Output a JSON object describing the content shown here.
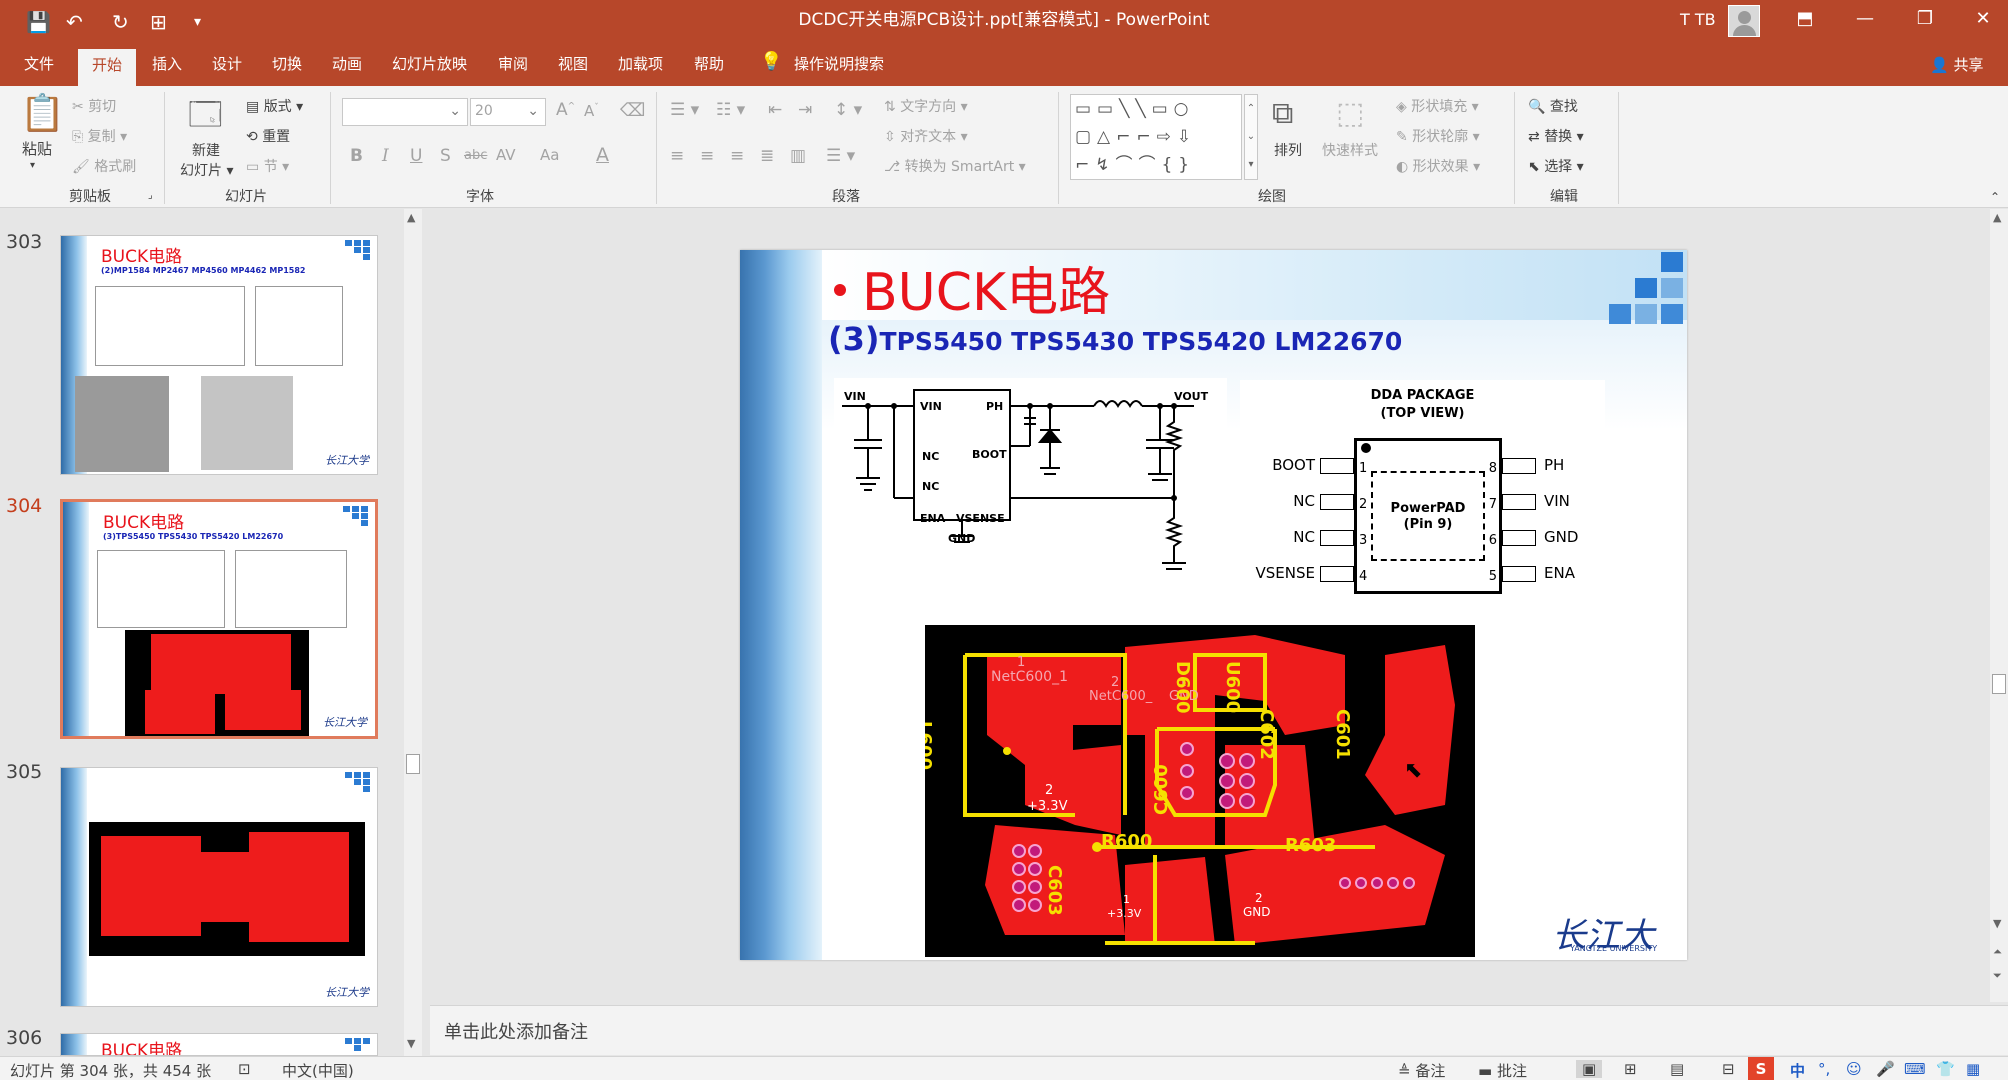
{
  "window": {
    "title": "DCDC开关电源PCB设计.ppt[兼容模式] - PowerPoint",
    "user": "T TB",
    "controls": {
      "minimize": "—",
      "restore": "❐",
      "close": "✕",
      "ribbon_display": "⬒"
    }
  },
  "tabs": [
    {
      "label": "文件"
    },
    {
      "label": "开始"
    },
    {
      "label": "插入"
    },
    {
      "label": "设计"
    },
    {
      "label": "切换"
    },
    {
      "label": "动画"
    },
    {
      "label": "幻灯片放映"
    },
    {
      "label": "审阅"
    },
    {
      "label": "视图"
    },
    {
      "label": "加载项"
    },
    {
      "label": "帮助"
    }
  ],
  "search_hint": "操作说明搜索",
  "share_label": "共享",
  "ribbon": {
    "clipboard": {
      "paste": "粘贴",
      "cut": "剪切",
      "copy": "复制",
      "format_painter": "格式刷",
      "group": "剪贴板"
    },
    "slides": {
      "new_slide": "新建\n幻灯片",
      "new_slide_l1": "新建",
      "new_slide_l2": "幻灯片",
      "layout": "版式",
      "reset": "重置",
      "section": "节",
      "group": "幻灯片"
    },
    "font": {
      "size": "20",
      "bold": "B",
      "italic": "I",
      "underline": "U",
      "shadow": "S",
      "strike": "abc",
      "spacing": "AV",
      "case": "Aa",
      "color": "A",
      "grow": "A",
      "shrink": "A",
      "group": "字体"
    },
    "paragraph": {
      "text_direction": "文字方向",
      "align_text": "对齐文本",
      "smartart": "转换为 SmartArt",
      "group": "段落"
    },
    "drawing": {
      "arrange": "排列",
      "quick_styles": "快速样式",
      "shape_fill": "形状填充",
      "shape_outline": "形状轮廓",
      "shape_effects": "形状效果",
      "group": "绘图"
    },
    "editing": {
      "find": "查找",
      "replace": "替换",
      "select": "选择",
      "group": "编辑"
    }
  },
  "thumbnails": [
    {
      "number": "303",
      "title": "BUCK电路",
      "subtitle": "(2)MP1584  MP2467  MP4560  MP4462  MP1582"
    },
    {
      "number": "304",
      "title": "BUCK电路",
      "subtitle": "(3)TPS5450 TPS5430 TPS5420 LM22670"
    },
    {
      "number": "305",
      "title": "",
      "subtitle": ""
    },
    {
      "number": "306",
      "title": "BUCK电路",
      "subtitle": ""
    }
  ],
  "slide": {
    "title": "BUCK电路",
    "subtitle_num": "(3)",
    "subtitle": "TPS5450 TPS5430 TPS5420 LM22670",
    "schematic": {
      "vin": "VIN",
      "vout": "VOUT",
      "pins": [
        "VIN",
        "PH",
        "NC",
        "BOOT",
        "NC",
        "ENA",
        "VSENSE",
        "GND"
      ]
    },
    "package": {
      "title": "DDA PACKAGE",
      "subtitle": "(TOP VIEW)",
      "center": "PowerPAD",
      "center2": "(Pin 9)",
      "left_pins": [
        {
          "name": "BOOT",
          "num": "1"
        },
        {
          "name": "NC",
          "num": "2"
        },
        {
          "name": "NC",
          "num": "3"
        },
        {
          "name": "VSENSE",
          "num": "4"
        }
      ],
      "right_pins": [
        {
          "name": "PH",
          "num": "8"
        },
        {
          "name": "VIN",
          "num": "7"
        },
        {
          "name": "GND",
          "num": "6"
        },
        {
          "name": "ENA",
          "num": "5"
        }
      ]
    },
    "pcb_labels": {
      "net1": "NetC600_1",
      "net1n": "1",
      "net2": "NetC600_",
      "net2n": "2",
      "gnd1": "GND",
      "gnd1n": "1",
      "d600": "D600",
      "u600": "U600",
      "c602": "C602",
      "c601": "C601",
      "l600": "L600",
      "c600": "C600",
      "v33": "+3.3V",
      "v33n": "2",
      "r600": "R600",
      "r603": "R603",
      "c603": "C603",
      "v33b": "+3.3V",
      "v33bn": "1",
      "gnd2": "GND",
      "gnd2n": "2"
    },
    "logo": "长江大学",
    "logo_sub": "YANGTZE UNIVERSITY"
  },
  "notes_placeholder": "单击此处添加备注",
  "status": {
    "slide_info": "幻灯片 第 304 张，共 454 张",
    "language": "中文(中国)",
    "notes": "备注",
    "comments": "批注",
    "ime": "中"
  },
  "colors": {
    "accent": "#b7472a",
    "title_red": "#e8141c",
    "subtitle_blue": "#1a26b5",
    "pcb_red": "#ee1c1c",
    "pcb_yellow": "#f5e000"
  }
}
